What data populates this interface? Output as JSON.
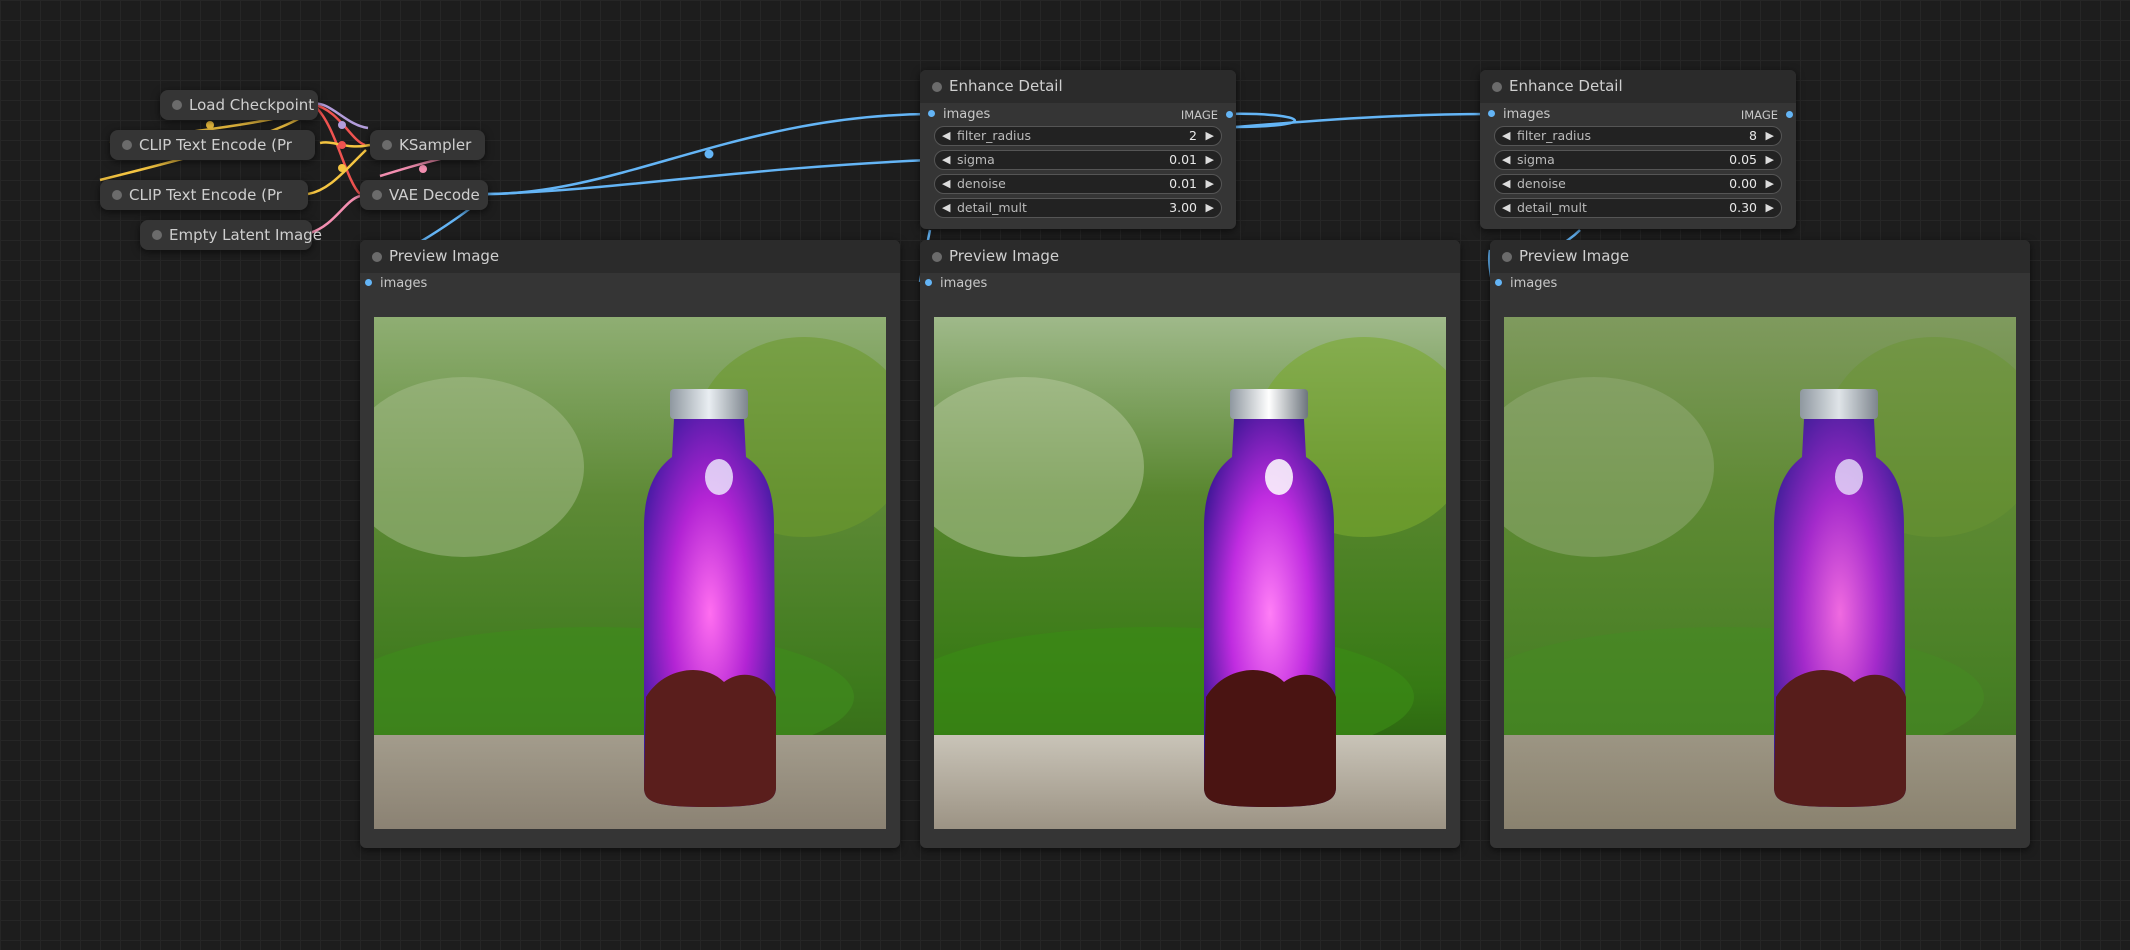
{
  "workflow": {
    "load_checkpoint": "Load Checkpoint",
    "clip_text_encode_1": "CLIP Text Encode (Pr",
    "clip_text_encode_2": "CLIP Text Encode (Pr",
    "empty_latent_image": "Empty Latent Image",
    "ksampler": "KSampler",
    "vae_decode": "VAE Decode"
  },
  "enhance_nodes": [
    {
      "title": "Enhance Detail",
      "input_label": "images",
      "output_label": "IMAGE",
      "widgets": [
        {
          "label": "filter_radius",
          "value": "2"
        },
        {
          "label": "sigma",
          "value": "0.01"
        },
        {
          "label": "denoise",
          "value": "0.01"
        },
        {
          "label": "detail_mult",
          "value": "3.00"
        }
      ]
    },
    {
      "title": "Enhance Detail",
      "input_label": "images",
      "output_label": "IMAGE",
      "widgets": [
        {
          "label": "filter_radius",
          "value": "8"
        },
        {
          "label": "sigma",
          "value": "0.05"
        },
        {
          "label": "denoise",
          "value": "0.00"
        },
        {
          "label": "detail_mult",
          "value": "0.30"
        }
      ]
    }
  ],
  "preview_nodes": [
    {
      "title": "Preview Image",
      "input_label": "images"
    },
    {
      "title": "Preview Image",
      "input_label": "images"
    },
    {
      "title": "Preview Image",
      "input_label": "images"
    }
  ],
  "colors": {
    "image_wire": "#64b5f6",
    "clip_wire": "#f5c542",
    "model_wire": "#b39ddb",
    "latent_wire": "#f48fb1",
    "vae_wire": "#ef5350",
    "node_body": "#353535",
    "node_title": "#2b2b2b",
    "canvas": "#1d1d1d"
  }
}
